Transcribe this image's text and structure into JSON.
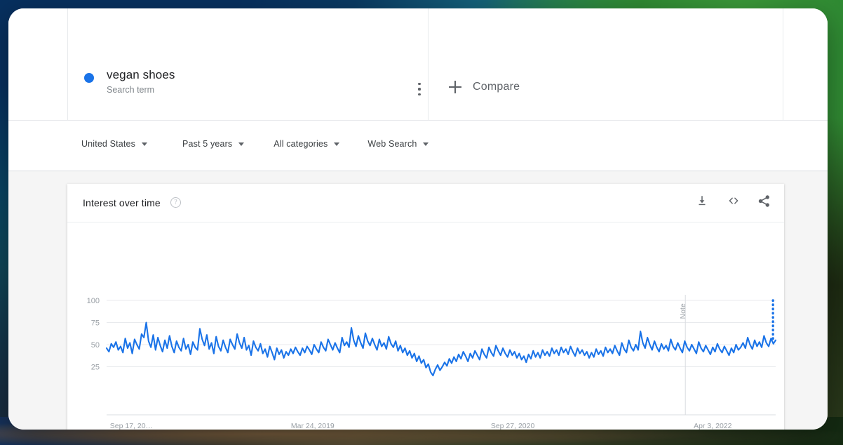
{
  "window": {
    "background_panel_color": "#ffffff"
  },
  "term": {
    "dot_color": "#1a73e8",
    "name": "vegan shoes",
    "subtitle": "Search term",
    "menu_icon": "kebab-menu-icon"
  },
  "compare": {
    "label": "Compare",
    "icon": "plus-icon"
  },
  "filters": [
    {
      "id": "region",
      "label": "United States"
    },
    {
      "id": "time",
      "label": "Past 5 years"
    },
    {
      "id": "category",
      "label": "All categories"
    },
    {
      "id": "search",
      "label": "Web Search"
    }
  ],
  "chart_card": {
    "title": "Interest over time",
    "help_icon": "help-circle-icon",
    "actions": [
      {
        "id": "download",
        "icon": "download-icon"
      },
      {
        "id": "embed",
        "icon": "embed-code-icon"
      },
      {
        "id": "share",
        "icon": "share-icon"
      }
    ]
  },
  "annotation": {
    "note_label": "Note"
  },
  "chart_data": {
    "type": "line",
    "title": "Interest over time",
    "xlabel": "",
    "ylabel": "",
    "ylim": [
      0,
      100
    ],
    "grid": true,
    "legend_position": "none",
    "line_color": "#1a73e8",
    "series_name": "vegan shoes",
    "y_ticks": [
      25,
      50,
      75,
      100
    ],
    "x_tick_labels": [
      "Sep 17, 20…",
      "Mar 24, 2019",
      "Sep 27, 2020",
      "Apr 3, 2022"
    ],
    "x_tick_positions_pct": [
      0.5,
      30.8,
      60.7,
      90.6
    ],
    "partial_period_marker": {
      "x_pct": 99.6,
      "value": 100,
      "style": "dotted-vertical"
    },
    "note_marker": {
      "x_pct": 86.5,
      "label": "Note"
    },
    "values": [
      46,
      42,
      51,
      47,
      53,
      44,
      48,
      41,
      57,
      46,
      52,
      40,
      56,
      50,
      45,
      62,
      58,
      75,
      54,
      47,
      61,
      44,
      58,
      49,
      42,
      55,
      46,
      60,
      48,
      41,
      54,
      47,
      43,
      57,
      45,
      50,
      39,
      53,
      47,
      44,
      68,
      56,
      49,
      61,
      45,
      52,
      40,
      59,
      48,
      43,
      55,
      47,
      41,
      56,
      50,
      45,
      62,
      52,
      46,
      58,
      44,
      49,
      38,
      54,
      47,
      43,
      51,
      40,
      45,
      36,
      48,
      41,
      33,
      46,
      39,
      44,
      35,
      42,
      38,
      45,
      40,
      47,
      42,
      38,
      46,
      41,
      48,
      44,
      39,
      50,
      45,
      41,
      53,
      47,
      43,
      56,
      50,
      44,
      52,
      46,
      41,
      58,
      49,
      53,
      47,
      69,
      55,
      48,
      60,
      52,
      46,
      63,
      54,
      49,
      57,
      50,
      44,
      56,
      48,
      52,
      45,
      59,
      51,
      47,
      54,
      43,
      49,
      41,
      46,
      38,
      43,
      35,
      40,
      31,
      37,
      29,
      33,
      24,
      28,
      19,
      15,
      22,
      27,
      21,
      25,
      30,
      26,
      34,
      29,
      36,
      31,
      39,
      34,
      42,
      37,
      31,
      40,
      35,
      43,
      38,
      33,
      45,
      39,
      35,
      47,
      41,
      37,
      49,
      43,
      38,
      46,
      40,
      36,
      44,
      38,
      42,
      35,
      40,
      33,
      37,
      30,
      39,
      34,
      43,
      36,
      41,
      35,
      44,
      38,
      42,
      37,
      46,
      40,
      44,
      38,
      47,
      41,
      45,
      39,
      48,
      42,
      37,
      46,
      40,
      44,
      38,
      42,
      35,
      41,
      36,
      45,
      39,
      43,
      37,
      47,
      41,
      45,
      40,
      49,
      43,
      38,
      52,
      45,
      41,
      55,
      47,
      43,
      50,
      44,
      65,
      52,
      46,
      58,
      50,
      44,
      54,
      47,
      42,
      51,
      45,
      49,
      43,
      56,
      48,
      44,
      52,
      46,
      41,
      54,
      47,
      43,
      50,
      45,
      40,
      53,
      46,
      42,
      49,
      44,
      39,
      47,
      42,
      51,
      45,
      41,
      48,
      43,
      38,
      46,
      41,
      50,
      44,
      47,
      52,
      46,
      58,
      50,
      45,
      55,
      48,
      53,
      47,
      60,
      52,
      48,
      57,
      51,
      55
    ]
  }
}
